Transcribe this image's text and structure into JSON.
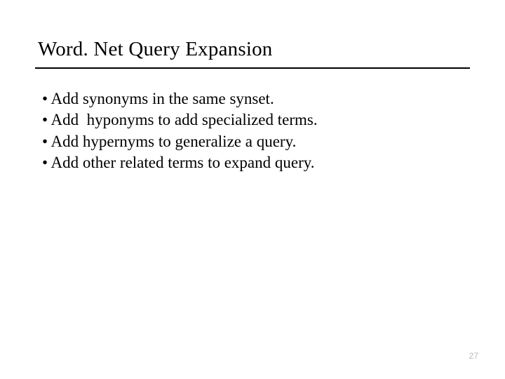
{
  "title": "Word. Net Query Expansion",
  "bullets": [
    "Add synonyms in the same synset.",
    "Add  hyponyms to add specialized terms.",
    "Add hypernyms to generalize a query.",
    "Add other related terms to expand query."
  ],
  "bullet_glyph": "•",
  "page_number": "27"
}
